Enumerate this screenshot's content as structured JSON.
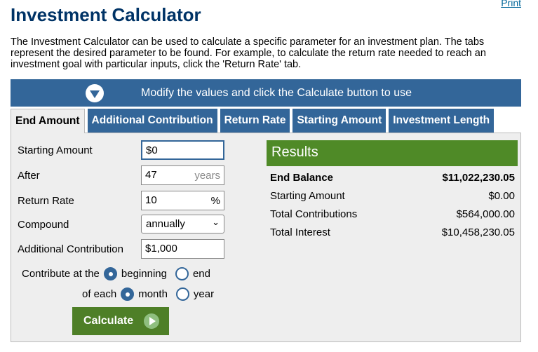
{
  "print_link": "Print",
  "title": "Investment Calculator",
  "intro": "The Investment Calculator can be used to calculate a specific parameter for an investment plan. The tabs represent the desired parameter to be found. For example, to calculate the return rate needed to reach an investment goal with particular inputs, click the 'Return Rate' tab.",
  "banner": {
    "text": "Modify the values and click the Calculate button to use",
    "icon": "chevron-down-circle-icon"
  },
  "tabs": [
    "End Amount",
    "Additional Contribution",
    "Return Rate",
    "Starting Amount",
    "Investment Length"
  ],
  "active_tab": "End Amount",
  "form": {
    "starting_amount": {
      "label": "Starting Amount",
      "value": "$0"
    },
    "after": {
      "label": "After",
      "value": "47",
      "unit": "years"
    },
    "return_rate": {
      "label": "Return Rate",
      "value": "10",
      "unit": "%"
    },
    "compound": {
      "label": "Compound",
      "value": "annually"
    },
    "additional": {
      "label": "Additional Contribution",
      "value": "$1,000"
    },
    "contribute_at": {
      "label": "Contribute at the",
      "options": [
        "beginning",
        "end"
      ],
      "selected": "beginning"
    },
    "of_each": {
      "label": "of each",
      "options": [
        "month",
        "year"
      ],
      "selected": "month"
    },
    "calculate": "Calculate"
  },
  "results": {
    "title": "Results",
    "rows": [
      {
        "label": "End Balance",
        "value": "$11,022,230.05"
      },
      {
        "label": "Starting Amount",
        "value": "$0.00"
      },
      {
        "label": "Total Contributions",
        "value": "$564,000.00"
      },
      {
        "label": "Total Interest",
        "value": "$10,458,230.05"
      }
    ]
  },
  "colors": {
    "primary": "#336699",
    "green": "#4f8a27",
    "title": "#003366"
  }
}
